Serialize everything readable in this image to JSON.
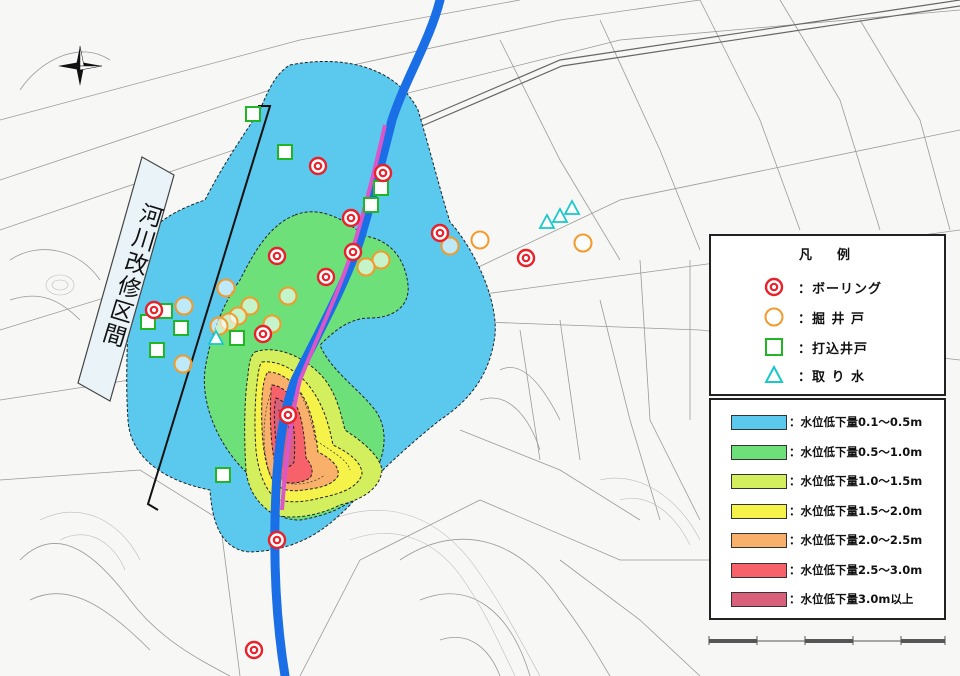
{
  "legend": {
    "title": "凡　例",
    "symbols": [
      {
        "key": "boring",
        "label": "：ボーリング",
        "shape": "double-circle",
        "color": "#e8212b"
      },
      {
        "key": "dug-well",
        "label": "：掘 井 戸",
        "shape": "circle",
        "color": "#f39a2b"
      },
      {
        "key": "driven-well",
        "label": "：打込井戸",
        "shape": "square",
        "color": "#22b526"
      },
      {
        "key": "water-intake",
        "label": "：取 り 水",
        "shape": "triangle",
        "color": "#18c8cc"
      }
    ]
  },
  "levels": [
    {
      "label": "：水位低下量0.1～0.5m",
      "color": "#5bc8ee"
    },
    {
      "label": "：水位低下量0.5～1.0m",
      "color": "#6ee07a"
    },
    {
      "label": "：水位低下量1.0～1.5m",
      "color": "#d4ef5e"
    },
    {
      "label": "：水位低下量1.5～2.0m",
      "color": "#f5f24a"
    },
    {
      "label": "：水位低下量2.0～2.5m",
      "color": "#f8b06a"
    },
    {
      "label": "：水位低下量2.5～3.0m",
      "color": "#f7626a"
    },
    {
      "label": "：水位低下量3.0m以上",
      "color": "#d8607a"
    }
  ],
  "section_label": "河川改修区間",
  "map_colors": {
    "river": "#1b6fe6",
    "channel": "#d957c9",
    "background": "#f7f7f5",
    "road": "#999999"
  },
  "points": {
    "boring": [
      [
        318,
        166
      ],
      [
        383,
        173
      ],
      [
        351,
        218
      ],
      [
        440,
        233
      ],
      [
        353,
        252
      ],
      [
        277,
        256
      ],
      [
        326,
        277
      ],
      [
        526,
        258
      ],
      [
        154,
        310
      ],
      [
        263,
        334
      ],
      [
        288,
        415
      ],
      [
        277,
        540
      ],
      [
        254,
        650
      ]
    ],
    "dug_well": [
      [
        381,
        260
      ],
      [
        366,
        267
      ],
      [
        450,
        246
      ],
      [
        480,
        240
      ],
      [
        583,
        243
      ],
      [
        288,
        296
      ],
      [
        226,
        288
      ],
      [
        250,
        306
      ],
      [
        184,
        306
      ],
      [
        238,
        316
      ],
      [
        229,
        322
      ],
      [
        219,
        326
      ],
      [
        272,
        324
      ],
      [
        183,
        364
      ]
    ],
    "driven_well": [
      [
        253,
        114
      ],
      [
        285,
        152
      ],
      [
        381,
        188
      ],
      [
        371,
        205
      ],
      [
        165,
        311
      ],
      [
        181,
        328
      ],
      [
        148,
        322
      ],
      [
        237,
        338
      ],
      [
        157,
        350
      ],
      [
        223,
        475
      ]
    ],
    "water_intake": [
      [
        547,
        222
      ],
      [
        560,
        216
      ],
      [
        572,
        208
      ],
      [
        216,
        338
      ]
    ]
  }
}
